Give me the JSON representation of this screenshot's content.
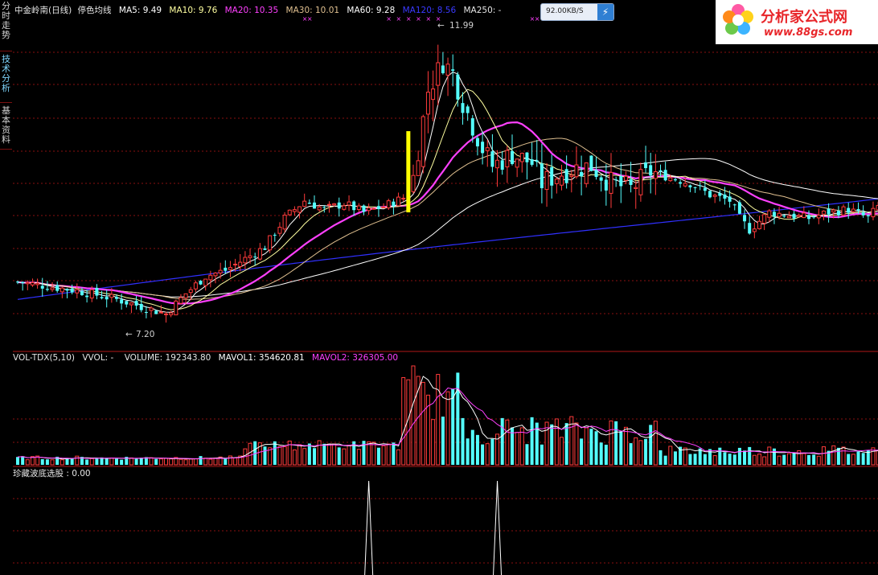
{
  "sidebar": {
    "tab_fenshi": "分时走势",
    "tab_jishu": "技术分析",
    "tab_jiben": "基本资料"
  },
  "price_panel": {
    "stock": "中金岭南(日线)",
    "indicator": "停色均线",
    "ma5": "MA5: 9.49",
    "ma10": "MA10: 9.76",
    "ma20": "MA20: 10.35",
    "ma30": "MA30: 10.01",
    "ma60": "MA60: 9.28",
    "ma120": "MA120: 8.56",
    "ma250": "MA250: -",
    "high_label": "11.99",
    "low_label": "7.20"
  },
  "volume_panel": {
    "name": "VOL-TDX(5,10)",
    "vvol": "VVOL: -",
    "volume": "VOLUME: 192343.80",
    "mavol1": "MAVOL1: 354620.81",
    "mavol2": "MAVOL2: 326305.00"
  },
  "indicator_panel": {
    "label": "珍藏波底选股 : 0.00"
  },
  "network": {
    "speed": "92.00KB/S"
  },
  "logo": {
    "title": "分析家公式网",
    "url": "www.88gs.com"
  },
  "colors": {
    "up": "#ff3b3b",
    "down": "#54ffff",
    "ma5": "#ffffff",
    "ma10": "#ffffa0",
    "ma20": "#ff40ff",
    "ma30": "#e0c090",
    "ma60": "#ffffff",
    "ma120": "#3030ff",
    "limit_up": "#ffff00",
    "grid": "#8a1010"
  },
  "chart_data": [
    {
      "type": "candlestick",
      "title": "中金岭南(日线)",
      "ylim": [
        6.8,
        12.4
      ],
      "high": 11.99,
      "low": 7.2,
      "series": [
        {
          "name": "MA5",
          "value": 9.49
        },
        {
          "name": "MA10",
          "value": 9.76
        },
        {
          "name": "MA20",
          "value": 10.35
        },
        {
          "name": "MA30",
          "value": 10.01
        },
        {
          "name": "MA60",
          "value": 9.28
        },
        {
          "name": "MA120",
          "value": 8.56
        }
      ],
      "price_path": [
        [
          0,
          7.9
        ],
        [
          12,
          7.75
        ],
        [
          20,
          7.6
        ],
        [
          26,
          7.45
        ],
        [
          30,
          7.35
        ],
        [
          34,
          7.7
        ],
        [
          38,
          8.0
        ],
        [
          42,
          8.1
        ],
        [
          46,
          8.3
        ],
        [
          50,
          8.5
        ],
        [
          54,
          9.0
        ],
        [
          58,
          9.3
        ],
        [
          62,
          9.15
        ],
        [
          66,
          9.25
        ],
        [
          70,
          9.1
        ],
        [
          74,
          9.2
        ],
        [
          78,
          9.35
        ],
        [
          80,
          9.7
        ],
        [
          83,
          11.2
        ],
        [
          86,
          11.7
        ],
        [
          88,
          11.5
        ],
        [
          90,
          11.0
        ],
        [
          92,
          10.6
        ],
        [
          94,
          10.2
        ],
        [
          96,
          9.9
        ],
        [
          98,
          10.0
        ],
        [
          100,
          10.1
        ],
        [
          104,
          9.95
        ],
        [
          106,
          9.6
        ],
        [
          108,
          9.7
        ],
        [
          112,
          9.85
        ],
        [
          116,
          9.9
        ],
        [
          120,
          9.6
        ],
        [
          124,
          9.5
        ],
        [
          128,
          9.8
        ],
        [
          132,
          9.7
        ],
        [
          136,
          9.6
        ],
        [
          140,
          9.4
        ],
        [
          144,
          9.3
        ],
        [
          146,
          9.0
        ],
        [
          148,
          8.8
        ],
        [
          152,
          9.1
        ],
        [
          156,
          9.05
        ],
        [
          160,
          9.0
        ],
        [
          164,
          9.1
        ],
        [
          168,
          9.15
        ],
        [
          172,
          9.0
        ],
        [
          175,
          9.3
        ]
      ],
      "limit_up_day": 79
    },
    {
      "type": "bar",
      "title": "VOL-TDX(5,10)",
      "series": [
        {
          "name": "VOLUME",
          "value": 192343.8
        },
        {
          "name": "MAVOL1",
          "value": 354620.81
        },
        {
          "name": "MAVOL2",
          "value": 326305.0
        }
      ]
    },
    {
      "type": "line",
      "title": "珍藏波底选股",
      "value": 0.0,
      "signal_days": [
        71,
        97
      ]
    }
  ]
}
